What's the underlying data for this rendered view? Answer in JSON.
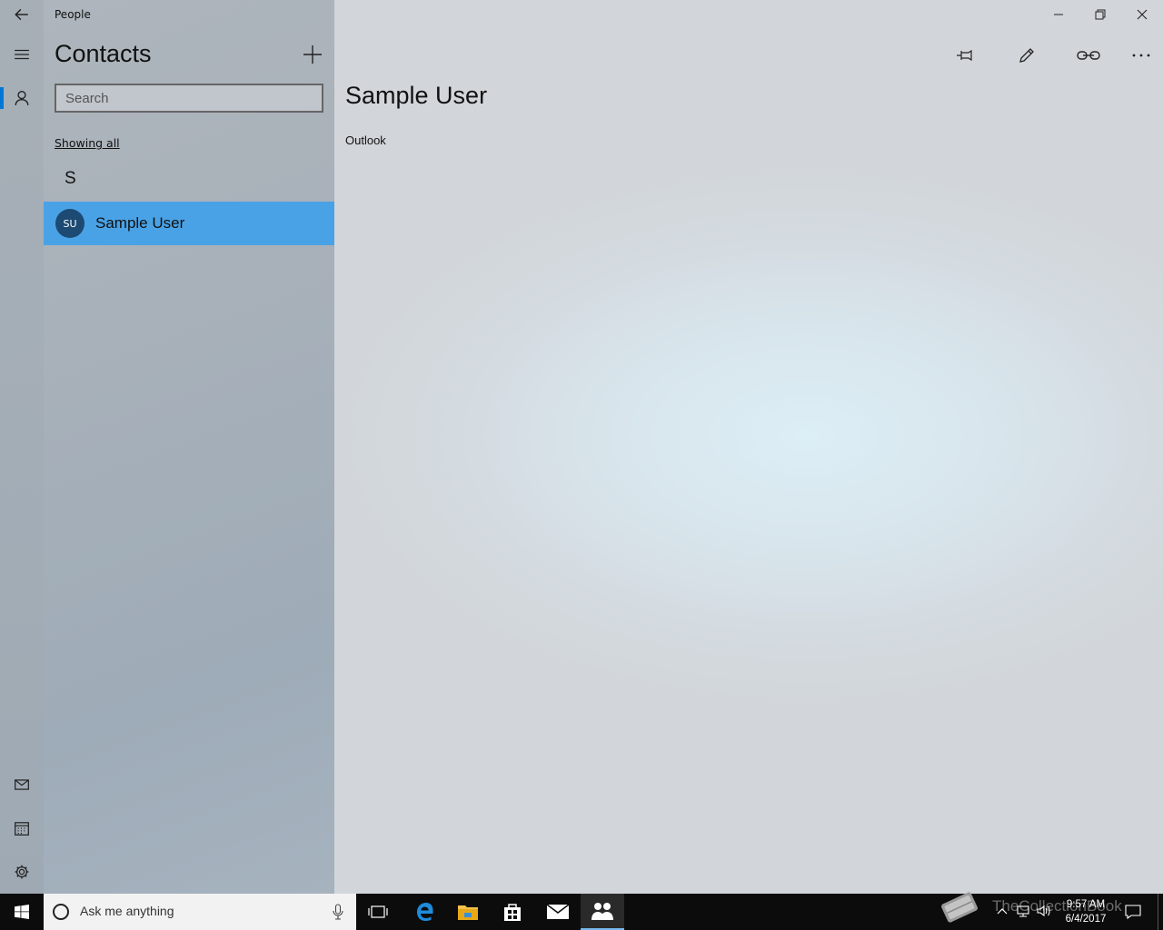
{
  "window": {
    "app_title": "People",
    "controls": [
      "minimize-icon",
      "restore-icon",
      "close-icon"
    ]
  },
  "nav_rail": {
    "items": [
      "back-arrow-icon",
      "hamburger-menu-icon",
      "person-icon"
    ],
    "bottom_items": [
      "mail-icon",
      "calendar-icon",
      "gear-icon"
    ],
    "accent": "#0078d7"
  },
  "contacts_pane": {
    "heading": "Contacts",
    "search": {
      "placeholder": "Search",
      "value": ""
    },
    "filter_link": "Showing all",
    "groups": [
      {
        "letter": "S",
        "contacts": [
          {
            "initials": "SU",
            "name": "Sample User",
            "selected": true
          }
        ]
      }
    ],
    "selected_color": "#4aa2e6"
  },
  "detail": {
    "name": "Sample User",
    "source": "Outlook",
    "toolbar": [
      "pin-icon",
      "edit-pencil-icon",
      "link-icon",
      "more-options-icon"
    ]
  },
  "taskbar": {
    "search_placeholder": "Ask me anything",
    "apps": [
      "task-view-icon",
      "edge-icon",
      "file-explorer-icon",
      "store-icon",
      "mail-icon",
      "people-icon"
    ],
    "clock_time": "9:57 AM",
    "clock_date": "6/4/2017",
    "watermark": "TheCollectionBook"
  }
}
